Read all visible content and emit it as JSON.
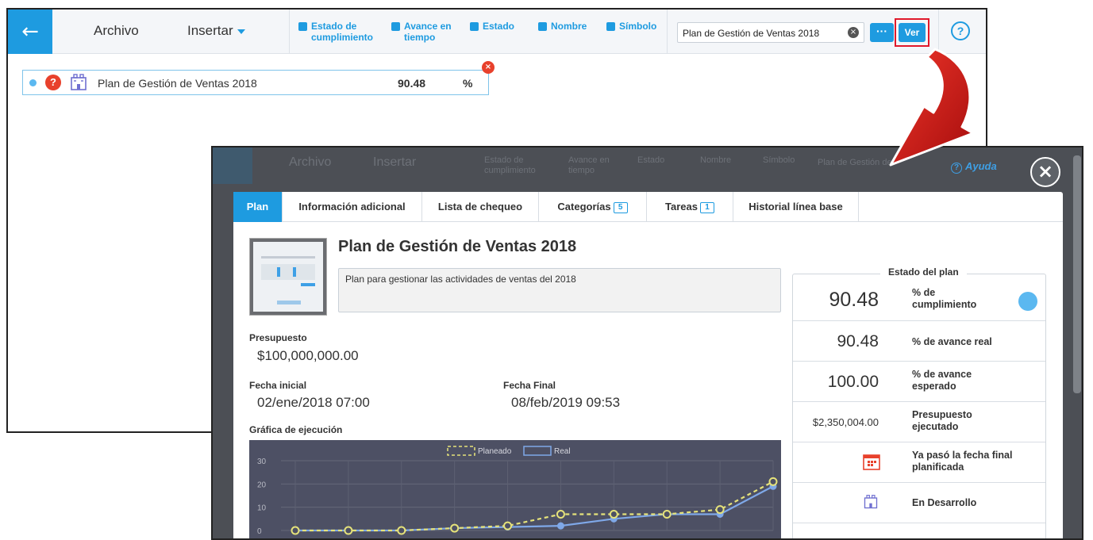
{
  "toolbar": {
    "back_icon": "←",
    "archivo": "Archivo",
    "insertar": "Insertar",
    "checks": [
      {
        "label_line1": "Estado de",
        "label_line2": "cumplimiento"
      },
      {
        "label_line1": "Avance en",
        "label_line2": "tiempo"
      },
      {
        "label_line1": "Estado",
        "label_line2": ""
      },
      {
        "label_line1": "Nombre",
        "label_line2": ""
      },
      {
        "label_line1": "Símbolo",
        "label_line2": ""
      }
    ],
    "search_value": "Plan de Gestión de Ventas 2018",
    "clear_icon": "×",
    "more_label": "···",
    "ver_label": "Ver",
    "help_icon": "?"
  },
  "plan_row": {
    "name": "Plan de Gestión de Ventas 2018",
    "value": "90.48",
    "unit": "%",
    "status_icon": "?",
    "remove_icon": "×"
  },
  "modal": {
    "ghost": {
      "archivo": "Archivo",
      "insertar": "Insertar",
      "checks": [
        "Estado de cumplimiento",
        "Avance en tiempo",
        "Estado",
        "Nombre",
        "Símbolo"
      ],
      "search": "Plan de Gestión de"
    },
    "help_label": "Ayuda",
    "help_icon": "?",
    "close_icon": "×",
    "tabs": [
      {
        "label": "Plan",
        "badge": ""
      },
      {
        "label": "Información adicional",
        "badge": ""
      },
      {
        "label": "Lista de chequeo",
        "badge": ""
      },
      {
        "label": "Categorías",
        "badge": "5"
      },
      {
        "label": "Tareas",
        "badge": "1"
      },
      {
        "label": "Historial línea base",
        "badge": ""
      }
    ],
    "title": "Plan de Gestión de Ventas 2018",
    "description": "Plan para gestionar las actividades de ventas del 2018",
    "budget_label": "Presupuesto",
    "budget_value": "$100,000,000.00",
    "start_label": "Fecha inicial",
    "start_value": "02/ene/2018 07:00",
    "end_label": "Fecha Final",
    "end_value": "08/feb/2019 09:53",
    "chart_label": "Gráfica de ejecución",
    "status": {
      "title": "Estado del plan",
      "rows": [
        {
          "value": "90.48",
          "label": "% de cumplimiento"
        },
        {
          "value": "90.48",
          "label": "% de avance real"
        },
        {
          "value": "100.00",
          "label": "% de avance esperado"
        },
        {
          "value": "$2,350,004.00",
          "label": "Presupuesto ejecutado"
        },
        {
          "value": "",
          "label": "Ya pasó la fecha final planificada",
          "icon": "calendar-icon"
        },
        {
          "value": "",
          "label": "En Desarrollo",
          "icon": "building-icon"
        }
      ]
    }
  },
  "chart_data": {
    "type": "line",
    "ylim": [
      0,
      30
    ],
    "yticks": [
      "0",
      "10",
      "20",
      "30"
    ],
    "series": [
      {
        "name": "Planeado",
        "values": [
          0,
          0,
          0,
          1,
          2,
          7,
          7,
          7,
          9,
          21
        ],
        "color": "#e5e27a"
      },
      {
        "name": "Real",
        "values": [
          0,
          0,
          0,
          1,
          1.5,
          2,
          5,
          7,
          7,
          19
        ],
        "color": "#7fa8e8"
      }
    ]
  },
  "colors": {
    "accent": "#1e9be0",
    "danger": "#e8412c",
    "chart_bg": "#4d5064"
  }
}
